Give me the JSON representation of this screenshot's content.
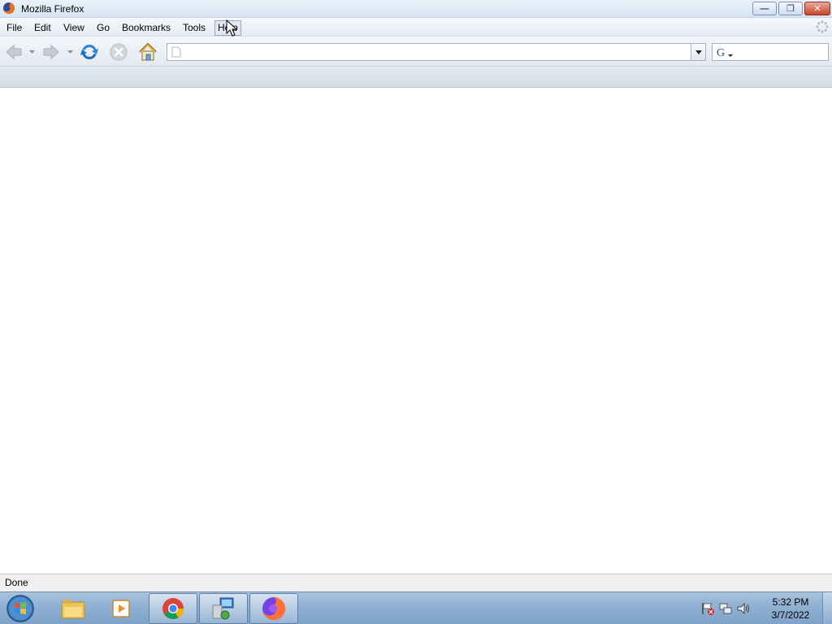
{
  "window": {
    "title": "Mozilla Firefox",
    "buttons": [
      "minimize",
      "restore",
      "close"
    ]
  },
  "menubar": {
    "items": [
      {
        "label": "File"
      },
      {
        "label": "Edit"
      },
      {
        "label": "View"
      },
      {
        "label": "Go"
      },
      {
        "label": "Bookmarks"
      },
      {
        "label": "Tools"
      },
      {
        "label": "Help"
      }
    ]
  },
  "navbar": {
    "icons": [
      "back-icon",
      "forward-icon",
      "reload-icon",
      "stop-icon",
      "home-icon"
    ],
    "url": {
      "value": "",
      "placeholder": ""
    },
    "search": {
      "value": "",
      "placeholder": "",
      "engine_icon": "google-icon"
    }
  },
  "statusbar": {
    "text": "Done"
  },
  "taskbar": {
    "items": [
      "start-icon",
      "file-explorer-icon",
      "media-player-icon",
      "chrome-icon",
      "remote-desktop-icon",
      "firefox-icon"
    ],
    "tray": [
      "action-center-flag-icon",
      "network-icon",
      "volume-icon"
    ],
    "clock": {
      "time": "5:32 PM",
      "date": "3/7/2022"
    }
  },
  "colors": {
    "titlebar": "#d7e4f4",
    "taskbar": "#8fb0d2",
    "close_button": "#c8442c"
  }
}
